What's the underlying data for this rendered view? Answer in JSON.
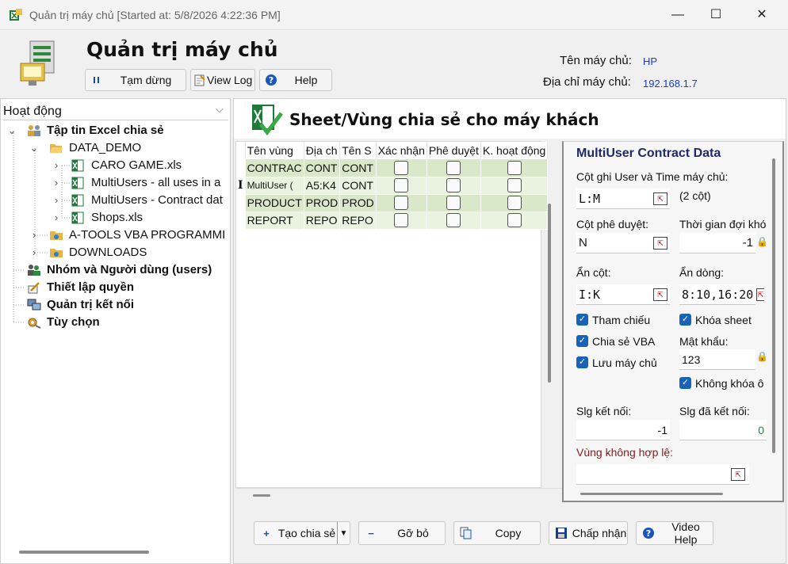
{
  "window": {
    "title": "Quản trị máy chủ [Started at: 5/8/2026 4:22:36 PM]",
    "minimize": "—",
    "maximize": "☐",
    "close": "✕"
  },
  "header": {
    "title": "Quản trị máy chủ",
    "buttons": {
      "pause": "Tạm dừng",
      "view_log": "View Log",
      "help": "Help"
    },
    "server_name_label": "Tên máy chủ:",
    "server_name": "HP",
    "server_addr_label": "Địa chỉ máy chủ:",
    "server_addr": "192.168.1.7"
  },
  "sidebar": {
    "dropdown_value": "Hoạt động",
    "tree": {
      "excel_files": "Tập tin Excel chia sẻ",
      "data_demo": "DATA_DEMO",
      "file1": "CARO GAME.xls",
      "file2": "MultiUsers - all uses in a",
      "file3": "MultiUsers - Contract dat",
      "file4": "Shops.xls",
      "folder2": "A-TOOLS VBA PROGRAMMI",
      "folder3": "DOWNLOADS",
      "groups": "Nhóm và Người dùng (users)",
      "permissions": "Thiết lập quyền",
      "connections": "Quản trị kết nối",
      "options": "Tùy chọn"
    }
  },
  "main": {
    "title": "Sheet/Vùng chia sẻ cho máy khách",
    "grid": {
      "columns": [
        "Tên vùng",
        "Địa ch",
        "Tên S",
        "Xác nhận",
        "Phê duyệt",
        "K. hoạt động"
      ],
      "rows": [
        [
          "CONTRAC",
          "CONT",
          "CONT"
        ],
        [
          "MultiUser (",
          "A5:K4",
          "CONT"
        ],
        [
          "PRODUCT",
          "PROD",
          "PROD"
        ],
        [
          "REPORT",
          "REPO",
          "REPO"
        ]
      ],
      "row_indicator": "I"
    },
    "detail": {
      "title": "MultiUser Contract Data",
      "user_time_col_label": "Cột ghi User và Time máy chủ:",
      "user_time_col": "L:M",
      "user_time_note": "(2 cột)",
      "approve_col_label": "Cột phê duyệt:",
      "approve_col": "N",
      "lock_wait_label": "Thời gian đợi khóa",
      "lock_wait": "-1",
      "hide_cols_label": "Ẩn cột:",
      "hide_cols": "I:K",
      "hide_rows_label": "Ẩn dòng:",
      "hide_rows": "8:10,16:20",
      "chk_reference": "Tham chiếu",
      "chk_lock_sheet": "Khóa sheet",
      "chk_share_vba": "Chia sẻ VBA",
      "password_label": "Mật khẩu:",
      "password": "123",
      "chk_save_server": "Lưu máy chủ",
      "chk_no_lock_cell": "Không khóa ô",
      "conn_count_label": "Slg kết nối:",
      "conn_count": "-1",
      "connected_label": "Slg đã kết nối:",
      "connected": "0",
      "invalid_range_label": "Vùng không hợp lệ:",
      "invalid_range": ""
    }
  },
  "footer": {
    "create_share": "Tạo chia sẻ",
    "remove": "Gỡ bỏ",
    "copy": "Copy",
    "accept": "Chấp nhận",
    "video_help": "Video Help"
  },
  "colors": {
    "accent": "#1862b8",
    "grid_row": "#d9e8c8",
    "title_blue": "#1e2a6b",
    "invalid_label": "#8b1a1a"
  }
}
